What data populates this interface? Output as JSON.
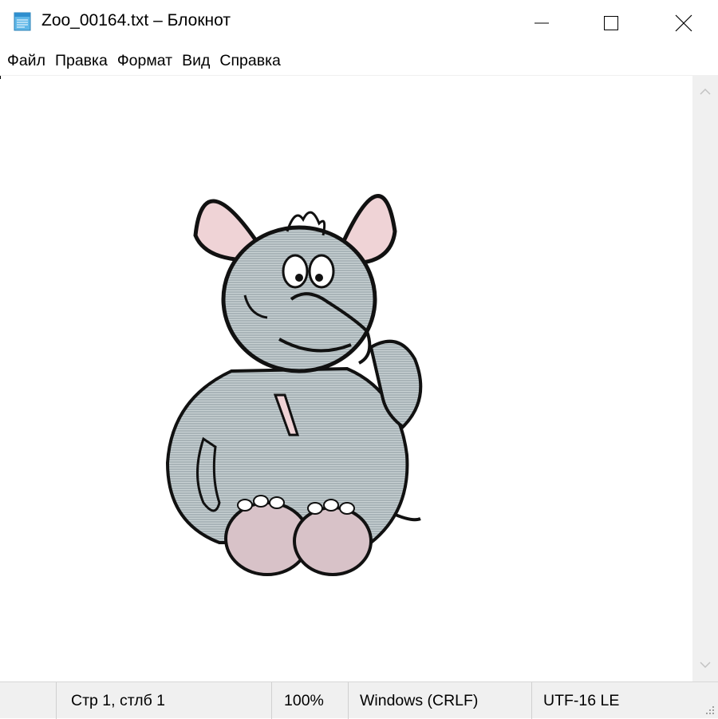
{
  "window": {
    "title": "Zoo_00164.txt – Блокнот",
    "app_icon": "notepad-icon",
    "controls": [
      "minimize-icon",
      "maximize-icon",
      "close-icon"
    ]
  },
  "menu": {
    "items": [
      {
        "label": "Файл"
      },
      {
        "label": "Правка"
      },
      {
        "label": "Формат"
      },
      {
        "label": "Вид"
      },
      {
        "label": "Справка"
      }
    ]
  },
  "editor": {
    "content": "ascii-art-elephant",
    "scrollbar_icons": [
      "chevron-up-icon",
      "chevron-down-icon"
    ]
  },
  "status": {
    "position": "Стр 1, стлб 1",
    "zoom": "100%",
    "line_endings": "Windows (CRLF)",
    "encoding": "UTF-16 LE"
  },
  "colors": {
    "elephant_body": "#a9b4b8",
    "elephant_ears_inner": "#efd3d6",
    "elephant_feet": "#d8c2c8",
    "outline": "#111111",
    "statusbar_bg": "#f0f0f0"
  }
}
